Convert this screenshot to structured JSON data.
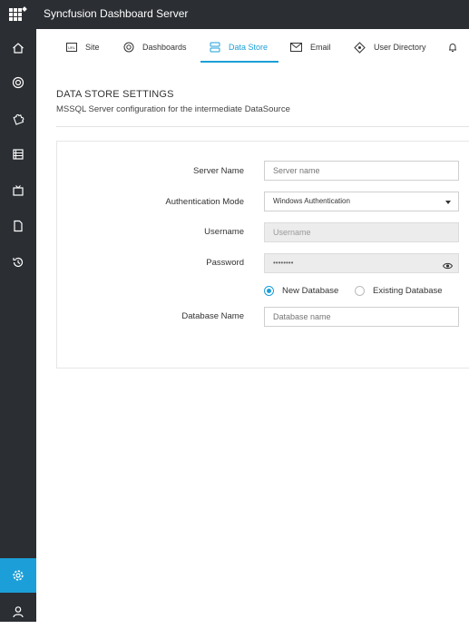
{
  "app": {
    "title": "Syncfusion Dashboard Server"
  },
  "sidebar": {
    "items": [
      {
        "icon": "home-icon"
      },
      {
        "icon": "dashboards-icon"
      },
      {
        "icon": "puzzle-icon"
      },
      {
        "icon": "datasource-list-icon"
      },
      {
        "icon": "schedule-tv-icon"
      },
      {
        "icon": "file-icon"
      },
      {
        "icon": "history-icon"
      },
      {
        "icon": "settings-gear-icon",
        "active": true
      },
      {
        "icon": "user-icon"
      }
    ]
  },
  "tabs": [
    {
      "label": "Site",
      "icon": "url-icon"
    },
    {
      "label": "Dashboards",
      "icon": "dashboards-icon"
    },
    {
      "label": "Data Store",
      "icon": "database-icon",
      "active": true
    },
    {
      "label": "Email",
      "icon": "envelope-icon"
    },
    {
      "label": "User Directory",
      "icon": "directory-icon"
    },
    {
      "label": "",
      "icon": "bell-icon"
    }
  ],
  "section": {
    "title": "DATA STORE SETTINGS",
    "subtitle": "MSSQL Server configuration for the intermediate DataSource"
  },
  "form": {
    "server_name": {
      "label": "Server Name",
      "placeholder": "Server name",
      "value": ""
    },
    "auth_mode": {
      "label": "Authentication Mode",
      "value": "Windows Authentication"
    },
    "username": {
      "label": "Username",
      "placeholder": "Username",
      "disabled": true
    },
    "password": {
      "label": "Password",
      "value": "••••••••",
      "disabled": true
    },
    "database_option": {
      "new_label": "New Database",
      "existing_label": "Existing Database",
      "selected": "New Database"
    },
    "database_name": {
      "label": "Database Name",
      "placeholder": "Database name",
      "value": ""
    }
  },
  "colors": {
    "accent": "#1c9fd8",
    "sidebar_bg": "#2b2e33"
  }
}
